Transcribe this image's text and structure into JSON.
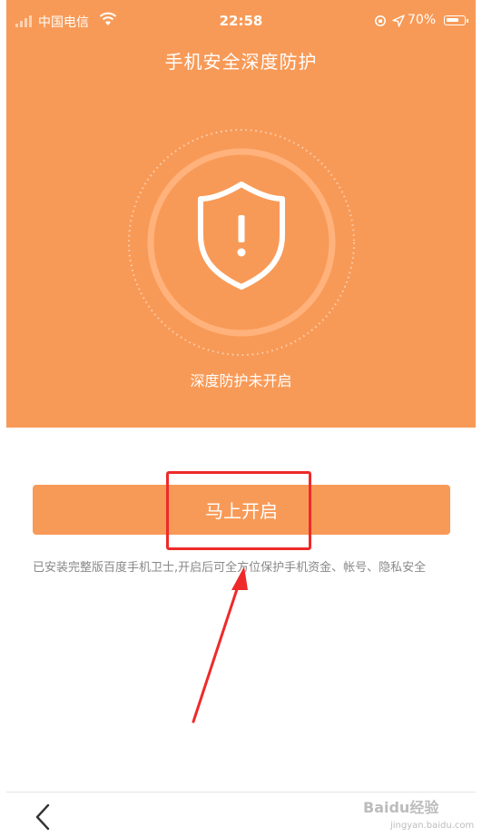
{
  "status_bar": {
    "carrier": "中国电信",
    "time": "22:58",
    "battery_percent": "70%",
    "battery_level": 0.7
  },
  "header": {
    "title": "手机安全深度防护"
  },
  "hero": {
    "status": "深度防护未开启",
    "shield_symbol": "!"
  },
  "action": {
    "button_label": "马上开启",
    "description": "已安装完整版百度手机卫士,开启后可全方位保护手机资金、帐号、隐私安全"
  },
  "nav": {
    "back_icon": "chevron-left-icon"
  },
  "watermark": {
    "brand": "Baidu经验",
    "url": "jingyan.baidu.com"
  },
  "colors": {
    "accent": "#F89A57",
    "annotation": "#EE2A2A"
  }
}
